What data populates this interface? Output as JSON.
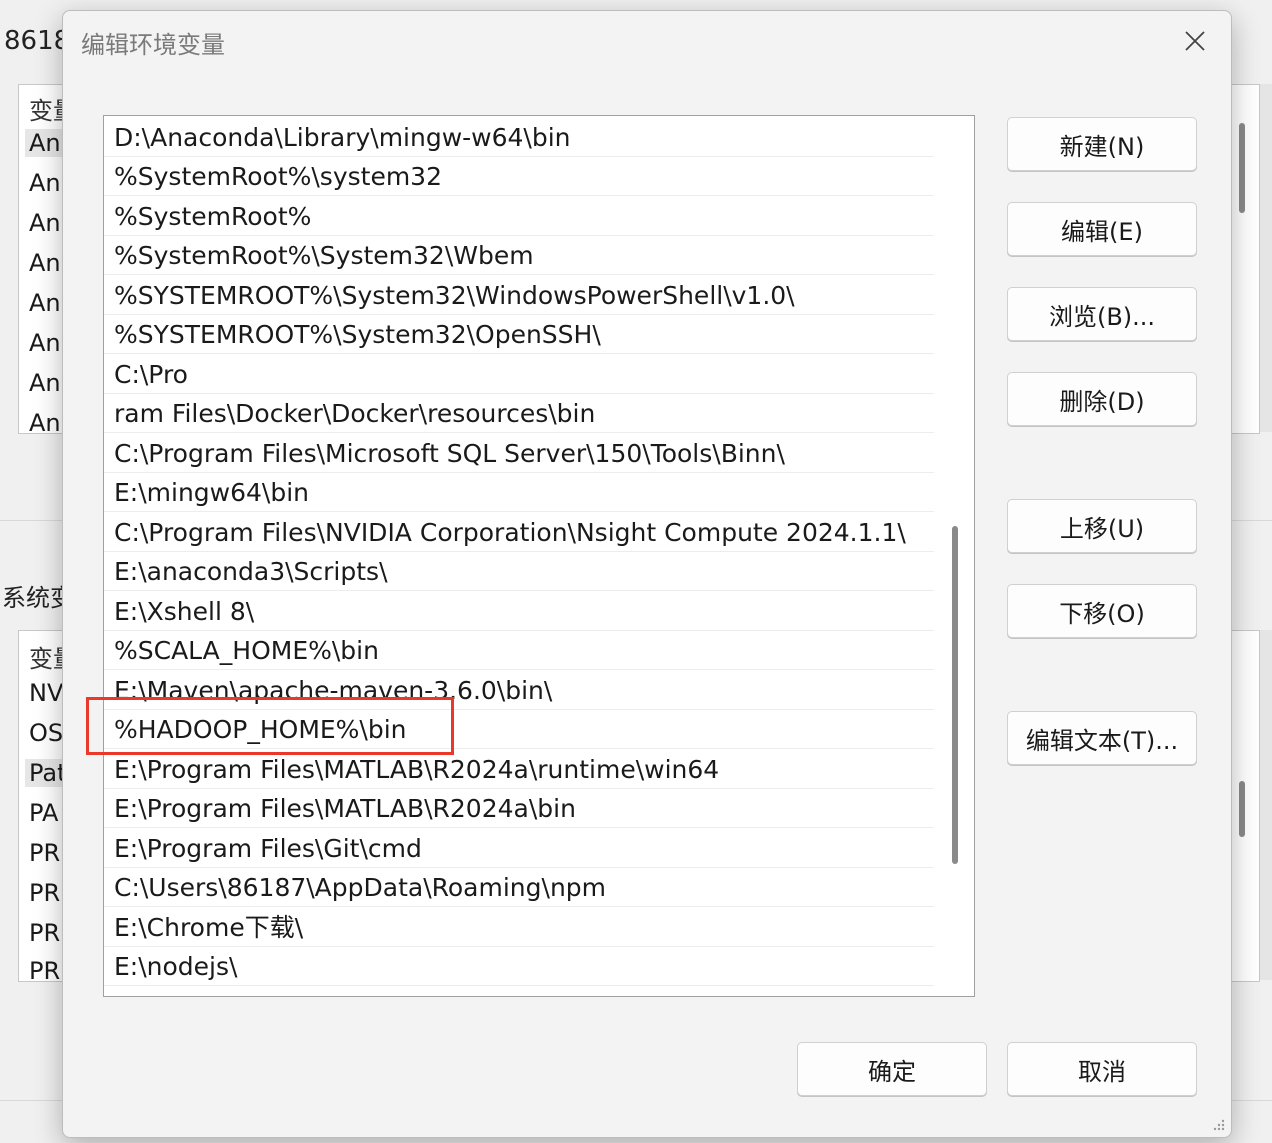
{
  "background": {
    "title_fragment": "8618",
    "user_vars_header": "变量",
    "user_vars_rows": [
      "An",
      "An",
      "An",
      "An",
      "An",
      "An",
      "An",
      "An"
    ],
    "system_section_label": "系统变",
    "system_vars_header": "变量",
    "system_vars_rows": [
      "NV",
      "OS",
      "Pat",
      "PA",
      "PR",
      "PR",
      "PR",
      "PR"
    ]
  },
  "dialog": {
    "title": "编辑环境变量",
    "close_icon": "close-icon",
    "entries": [
      "D:\\Anaconda\\Library\\mingw-w64\\bin",
      "%SystemRoot%\\system32",
      "%SystemRoot%",
      "%SystemRoot%\\System32\\Wbem",
      "%SYSTEMROOT%\\System32\\WindowsPowerShell\\v1.0\\",
      "%SYSTEMROOT%\\System32\\OpenSSH\\",
      "C:\\Pro",
      "ram Files\\Docker\\Docker\\resources\\bin",
      "C:\\Program Files\\Microsoft SQL Server\\150\\Tools\\Binn\\",
      "E:\\mingw64\\bin",
      "C:\\Program Files\\NVIDIA Corporation\\Nsight Compute 2024.1.1\\",
      "E:\\anaconda3\\Scripts\\",
      "E:\\Xshell 8\\",
      "%SCALA_HOME%\\bin",
      "E:\\Maven\\apache-maven-3.6.0\\bin\\",
      "%HADOOP_HOME%\\bin",
      "E:\\Program Files\\MATLAB\\R2024a\\runtime\\win64",
      "E:\\Program Files\\MATLAB\\R2024a\\bin",
      "E:\\Program Files\\Git\\cmd",
      "C:\\Users\\86187\\AppData\\Roaming\\npm",
      "E:\\Chrome下载\\",
      "E:\\nodejs\\"
    ],
    "highlighted_entry": "%HADOOP_HOME%\\bin",
    "highlight_color": "#e8392a",
    "buttons": {
      "new": "新建(N)",
      "edit": "编辑(E)",
      "browse": "浏览(B)...",
      "delete": "删除(D)",
      "move_up": "上移(U)",
      "move_down": "下移(O)",
      "edit_text": "编辑文本(T)...",
      "ok": "确定",
      "cancel": "取消"
    }
  }
}
